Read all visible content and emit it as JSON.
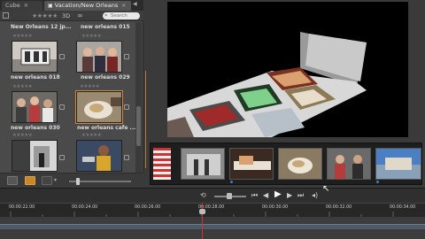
{
  "tabs": [
    {
      "label": "Cube"
    },
    {
      "label": "Vacation/New Orleans"
    }
  ],
  "filter": {
    "stars": "★★★★★",
    "label_3d": "3D",
    "search_placeholder": "Search"
  },
  "library": {
    "items": [
      {
        "title": "New Orleans 12 jp...",
        "stars": "★★★★★"
      },
      {
        "title": "new orleans 015",
        "stars": "★★★★★"
      },
      {
        "title": "new orleans 018",
        "stars": "★★★★★"
      },
      {
        "title": "new orleans 029",
        "stars": "★★★★★"
      },
      {
        "title": "new orleans 030",
        "stars": "★★★★★"
      },
      {
        "title": "new orleans cafe ...",
        "stars": "★★★★★"
      },
      {
        "title": "",
        "stars": "★★★★★"
      },
      {
        "title": "",
        "stars": "★★★★★"
      }
    ]
  },
  "timeline": {
    "timecodes": [
      "00:00:22.00",
      "00:00:24.00",
      "00:00:26.00",
      "00:00:28.00",
      "00:00:30.00",
      "00:00:32.00",
      "00:00:34.00"
    ]
  },
  "transport": {
    "rewind": "⏮",
    "step_back": "◀",
    "play": "▶",
    "step_fwd": "▶",
    "forward": "⏭"
  },
  "colors": {
    "accent": "#d68a2a",
    "playhead": "#cc3333",
    "background": "#3a3a3a"
  }
}
